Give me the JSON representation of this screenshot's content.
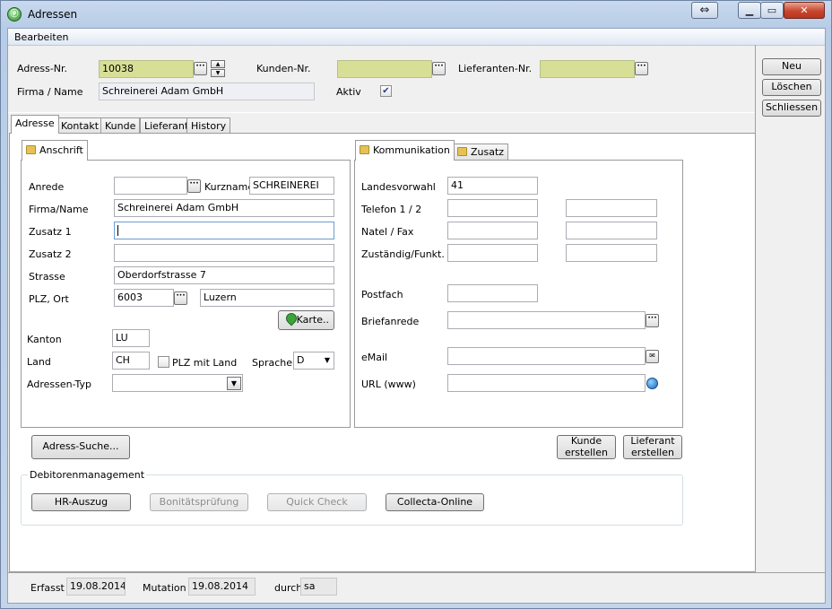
{
  "window": {
    "title": "Adressen"
  },
  "menu": {
    "bearbeiten": "Bearbeiten"
  },
  "header": {
    "adress_nr_label": "Adress-Nr.",
    "adress_nr_value": "10038",
    "kunden_nr_label": "Kunden-Nr.",
    "kunden_nr_value": "",
    "lieferanten_nr_label": "Lieferanten-Nr.",
    "lieferanten_nr_value": "",
    "firma_label": "Firma / Name",
    "firma_value": "Schreinerei Adam GmbH",
    "aktiv_label": "Aktiv",
    "aktiv_checked": true
  },
  "side_buttons": {
    "neu": "Neu",
    "loeschen": "Löschen",
    "schliessen": "Schliessen"
  },
  "tabs": [
    {
      "label": "Adresse",
      "active": true
    },
    {
      "label": "Kontakt"
    },
    {
      "label": "Kunde"
    },
    {
      "label": "Lieferant"
    },
    {
      "label": "History"
    }
  ],
  "anschrift": {
    "tab": "Anschrift",
    "anrede_label": "Anrede",
    "anrede_value": "",
    "kurzname_label": "Kurzname",
    "kurzname_value": "SCHREINEREI",
    "firma_label": "Firma/Name",
    "firma_value": "Schreinerei Adam GmbH",
    "zusatz1_label": "Zusatz 1",
    "zusatz1_value": "",
    "zusatz2_label": "Zusatz 2",
    "zusatz2_value": "",
    "strasse_label": "Strasse",
    "strasse_value": "Oberdorfstrasse 7",
    "plz_ort_label": "PLZ, Ort",
    "plz_value": "6003",
    "ort_value": "Luzern",
    "karte_label": "Karte..",
    "kanton_label": "Kanton",
    "kanton_value": "LU",
    "land_label": "Land",
    "land_value": "CH",
    "plz_mit_land_label": "PLZ mit Land",
    "sprache_label": "Sprache",
    "sprache_value": "D",
    "adressen_typ_label": "Adressen-Typ",
    "adressen_typ_value": ""
  },
  "kommunikation": {
    "tab": "Kommunikation",
    "tab2": "Zusatz",
    "landesvorwahl_label": "Landesvorwahl",
    "landesvorwahl_value": "41",
    "telefon_label": "Telefon 1 / 2",
    "natel_label": "Natel / Fax",
    "zustaendig_label": "Zuständig/Funkt.",
    "postfach_label": "Postfach",
    "briefanrede_label": "Briefanrede",
    "email_label": "eMail",
    "url_label": "URL (www)"
  },
  "actions": {
    "adress_suche": "Adress-Suche...",
    "kunde_erstellen_1": "Kunde",
    "kunde_erstellen_2": "erstellen",
    "lieferant_erstellen_1": "Lieferant",
    "lieferant_erstellen_2": "erstellen"
  },
  "debitoren": {
    "title": "Debitorenmanagement",
    "hr_auszug": "HR-Auszug",
    "bonitaet": "Bonitätsprüfung",
    "quick_check": "Quick Check",
    "collecta": "Collecta-Online"
  },
  "status": {
    "erfasst_label": "Erfasst",
    "erfasst_value": "19.08.2014",
    "mutation_label": "Mutation",
    "mutation_value": "19.08.2014",
    "durch_label": "durch",
    "durch_value": "sa"
  },
  "colors": {
    "required_field": "#d7df96",
    "close_button": "#c9452d"
  }
}
